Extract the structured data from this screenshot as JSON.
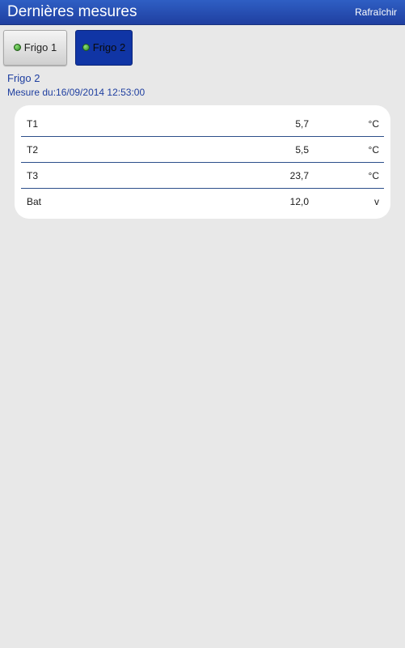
{
  "header": {
    "title": "Dernières mesures",
    "refresh_label": "Rafraîchir"
  },
  "tabs": [
    {
      "label": "Frigo 1",
      "status_icon": "led-green-icon",
      "selected": false
    },
    {
      "label": "Frigo 2",
      "status_icon": "led-green-icon",
      "selected": true
    }
  ],
  "detail": {
    "name": "Frigo 2",
    "measure_date": "Mesure du:16/09/2014 12:53:00"
  },
  "measures": [
    {
      "label": "T1",
      "value": "5,7",
      "unit": "°C"
    },
    {
      "label": "T2",
      "value": "5,5",
      "unit": "°C"
    },
    {
      "label": "T3",
      "value": "23,7",
      "unit": "°C"
    },
    {
      "label": "Bat",
      "value": "12,0",
      "unit": "v"
    }
  ],
  "colors": {
    "header_bg": "#2a55b8",
    "accent": "#1f3fa0",
    "selected_tab": "#1035a5",
    "background": "#e8e8e8",
    "led": "#3fa02a"
  }
}
